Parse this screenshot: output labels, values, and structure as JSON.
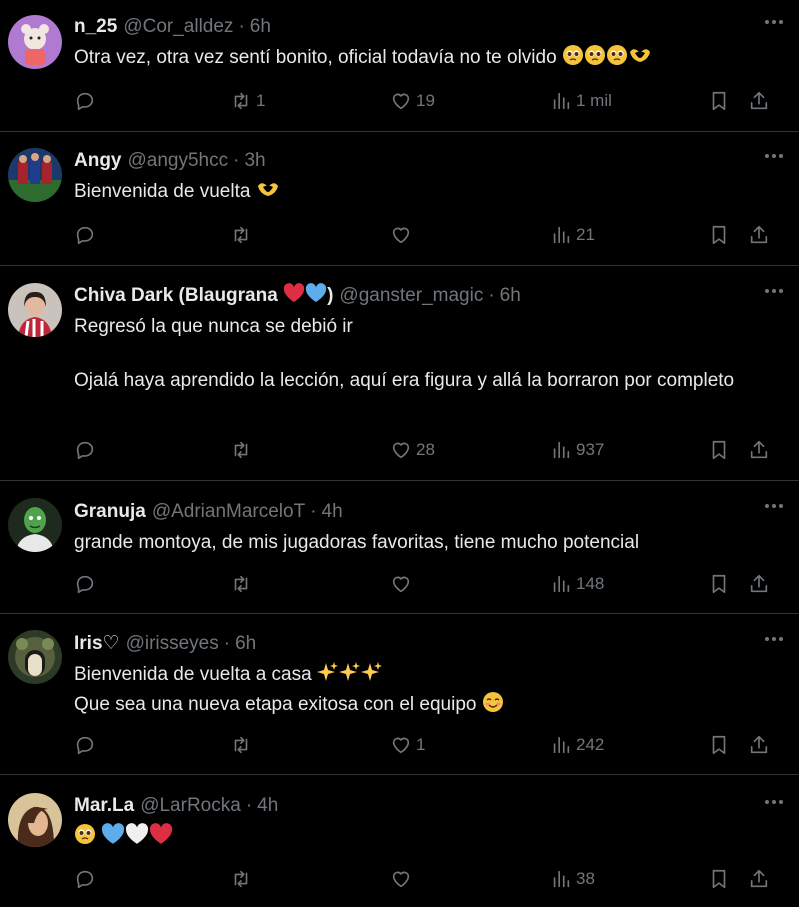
{
  "tweets": [
    {
      "name": "n_25",
      "name_emojis": [],
      "handle": "@Cor_alldez",
      "time": "6h",
      "text": "Otra vez, otra vez sentí bonito, oficial todavía no te olvido",
      "text_emojis": [
        "pleading-face-emoji",
        "pleading-face-emoji",
        "pleading-face-emoji",
        "heart-hands-emoji"
      ],
      "replies": "",
      "retweets": "1",
      "likes": "19",
      "views": "1 mil",
      "avatar_color": "#b07ad0"
    },
    {
      "name": "Angy",
      "name_emojis": [],
      "handle": "@angy5hcc",
      "time": "3h",
      "text": "Bienvenida de vuelta",
      "text_emojis": [
        "heart-hands-emoji"
      ],
      "replies": "",
      "retweets": "",
      "likes": "",
      "views": "21",
      "avatar_color": "#1b3a6b"
    },
    {
      "name": "Chiva Dark (Blaugrana",
      "name_emojis": [
        "red-heart-emoji",
        "blue-heart-emoji"
      ],
      "name_suffix": ")",
      "handle": "@ganster_magic",
      "time": "6h",
      "text": "Regresó la que nunca se debió ir\n\nOjalá haya aprendido la lección, aquí era figura y allá la borraron por completo",
      "text_emojis": [],
      "replies": "",
      "retweets": "",
      "likes": "28",
      "views": "937",
      "avatar_color": "#c9c2bd"
    },
    {
      "name": "Granuja",
      "name_emojis": [],
      "handle": "@AdrianMarceloT",
      "time": "4h",
      "text": "grande montoya, de mis jugadoras favoritas, tiene mucho potencial",
      "text_emojis": [],
      "replies": "",
      "retweets": "",
      "likes": "",
      "views": "148",
      "avatar_color": "#1d2a1d"
    },
    {
      "name": "Iris♡",
      "name_emojis": [],
      "handle": "@irisseyes",
      "time": "6h",
      "text": "Bienvenida de vuelta a casa",
      "text_emojis": [
        "sparkles-emoji",
        "sparkles-emoji",
        "sparkles-emoji"
      ],
      "line2": "Que sea una nueva etapa exitosa con el equipo",
      "line2_emojis": [
        "smiling-face-emoji"
      ],
      "replies": "",
      "retweets": "",
      "likes": "1",
      "views": "242",
      "avatar_color": "#2d3a26"
    },
    {
      "name": "Mar.La",
      "name_emojis": [],
      "handle": "@LarRocka",
      "time": "4h",
      "text": "",
      "text_emojis": [
        "pleading-face-emoji",
        "blue-heart-emoji",
        "white-heart-emoji",
        "red-heart-emoji"
      ],
      "replies": "",
      "retweets": "",
      "likes": "",
      "views": "38",
      "avatar_color": "#a57a4a"
    }
  ],
  "colors": {
    "background": "#000000",
    "text": "#e7e9ea",
    "muted": "#71767b",
    "divider": "#2f3336"
  }
}
